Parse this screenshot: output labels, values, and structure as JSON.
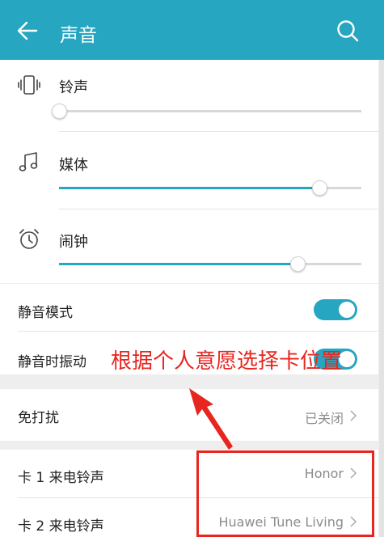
{
  "header": {
    "title": "声音",
    "back_icon": "arrow-left-icon",
    "search_icon": "search-icon"
  },
  "volume": {
    "ringtone": {
      "label": "铃声",
      "icon": "vibrate-phone-icon",
      "level": 0.0
    },
    "media": {
      "label": "媒体",
      "icon": "music-note-icon",
      "level": 0.86
    },
    "alarm": {
      "label": "闹钟",
      "icon": "alarm-clock-icon",
      "level": 0.79
    }
  },
  "toggles": {
    "silent_mode": {
      "label": "静音模式",
      "on": true
    },
    "vibrate_when_silent": {
      "label": "静音时振动",
      "on": true
    }
  },
  "dnd": {
    "label": "免打扰",
    "value": "已关闭"
  },
  "sim_ringtones": [
    {
      "label": "卡 1 来电铃声",
      "value": "Honor"
    },
    {
      "label": "卡 2 来电铃声",
      "value": "Huawei Tune Living"
    }
  ],
  "annotation": {
    "text": "根据个人意愿选择卡位置",
    "color": "#e8251f"
  },
  "colors": {
    "accent": "#26a6c0",
    "annotation": "#e8251f"
  }
}
